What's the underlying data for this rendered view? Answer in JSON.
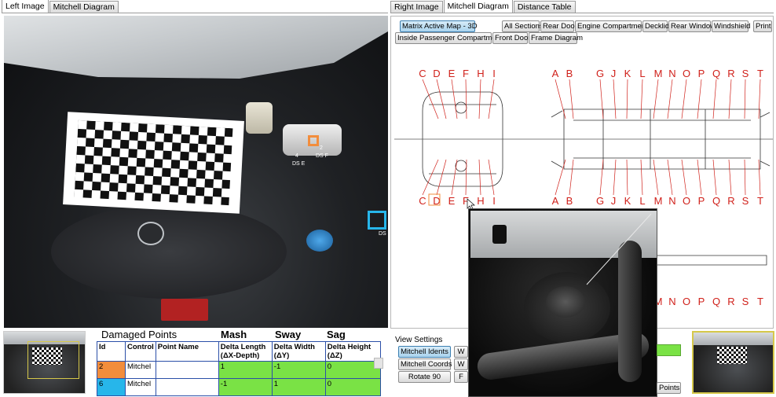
{
  "left_tabs": [
    "Left Image",
    "Mitchell Diagram"
  ],
  "right_tabs": [
    "Right Image",
    "Mitchell Diagram",
    "Distance Table"
  ],
  "right_active_tab": 1,
  "left_photo_labels": {
    "point4": "4",
    "point4_sub": "DS E",
    "point2": "2",
    "point2_sub": "DS F",
    "edge": "DS"
  },
  "toolbar": {
    "matrix_active_map": "Matrix Active Map - 3D",
    "all_sections": "All Sections",
    "rear_door": "Rear Door",
    "engine_compartment": "Engine Compartment",
    "decklid": "Decklid",
    "rear_window": "Rear Window",
    "windshield": "Windshield",
    "print": "Print",
    "inside_passenger_compartment": "Inside Passenger Compartment",
    "front_door": "Front Door",
    "frame_diagram": "Frame Diagram"
  },
  "diagram": {
    "front_letters": [
      "C",
      "D",
      "E",
      "F",
      "H",
      "I"
    ],
    "rear_letters": [
      "A",
      "B",
      "G",
      "J",
      "K",
      "L",
      "M",
      "N",
      "O",
      "P",
      "Q",
      "R",
      "S",
      "T"
    ],
    "lower_letters": [
      "M",
      "N",
      "O",
      "P",
      "Q",
      "R",
      "S",
      "T"
    ],
    "highlighted_letter": "D",
    "letter_color": "#d0201a"
  },
  "damaged": {
    "title": "Damaged Points",
    "mash": "Mash",
    "sway": "Sway",
    "sag": "Sag",
    "headers": {
      "id": "Id",
      "control": "Control",
      "point_name": "Point Name",
      "delta_length": "Delta Length",
      "delta_length_sub": "(ΔX-Depth)",
      "delta_width": "Delta Width",
      "delta_width_sub": "(ΔY)",
      "delta_height": "Delta Height",
      "delta_height_sub": "(ΔZ)"
    },
    "rows": [
      {
        "id": "2",
        "control": "Mitchel",
        "point_name": "",
        "dl": "1",
        "dw": "-1",
        "dh": "0",
        "color": "#f28d3c"
      },
      {
        "id": "6",
        "control": "Mitchel",
        "point_name": "",
        "dl": "-1",
        "dw": "1",
        "dh": "0",
        "color": "#27b6ea"
      }
    ]
  },
  "view_settings": {
    "label": "View Settings",
    "mitchell_idents": "Mitchell Idents",
    "mitchell_coords": "Mitchell Coords",
    "rotate_90": "Rotate 90",
    "partial_w1": "W",
    "partial_w2": "W",
    "partial_f": "F",
    "points": "Points"
  },
  "colors": {
    "accent": "#3c7fb1",
    "green": "#7ae245",
    "orange": "#f28d3c",
    "cyan": "#27b6ea",
    "table_border": "#2b4fa8"
  }
}
